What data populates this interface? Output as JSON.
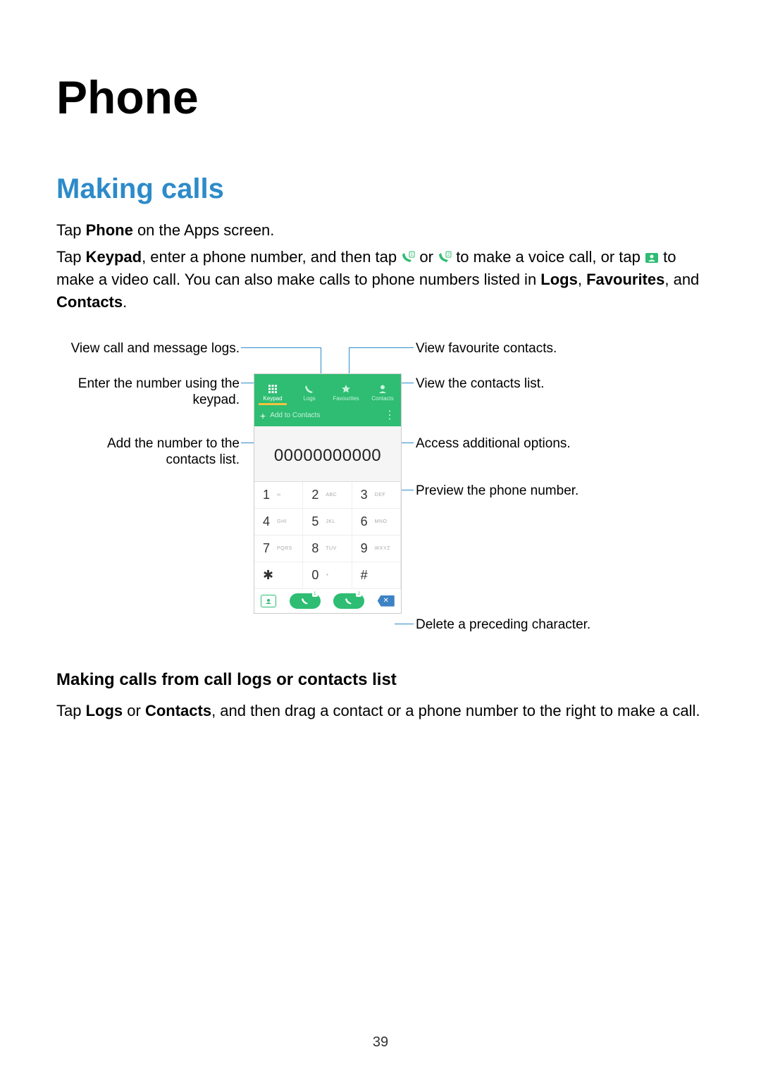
{
  "page": {
    "title": "Phone",
    "section": "Making calls",
    "para1_pre": "Tap ",
    "para1_bold": "Phone",
    "para1_post": " on the Apps screen.",
    "para2_a": "Tap ",
    "para2_keypad": "Keypad",
    "para2_b": ", enter a phone number, and then tap ",
    "para2_c": " or ",
    "para2_d": " to make a voice call, or tap ",
    "para2_e": " to make a video call. You can also make calls to phone numbers listed in ",
    "para2_logs": "Logs",
    "para2_f": ", ",
    "para2_fav": "Favourites",
    "para2_g": ", and ",
    "para2_contacts": "Contacts",
    "para2_h": ".",
    "subheading": "Making calls from call logs or contacts list",
    "para3_a": "Tap ",
    "para3_logs": "Logs",
    "para3_b": " or ",
    "para3_contacts": "Contacts",
    "para3_c": ", and then drag a contact or a phone number to the right to make a call.",
    "page_number": "39"
  },
  "callouts": {
    "left1": "View call and message logs.",
    "left2": "Enter the number using the keypad.",
    "left3": "Add the number to the contacts list.",
    "right1": "View favourite contacts.",
    "right2": "View the contacts list.",
    "right3": "Access additional options.",
    "right4": "Preview the phone number.",
    "right5": "Delete a preceding character."
  },
  "phone": {
    "tabs": [
      "Keypad",
      "Logs",
      "Favourites",
      "Contacts"
    ],
    "add_to_contacts": "Add to Contacts",
    "number": "00000000000",
    "keys": [
      {
        "d": "1",
        "s": ""
      },
      {
        "d": "2",
        "s": "ABC"
      },
      {
        "d": "3",
        "s": "DEF"
      },
      {
        "d": "4",
        "s": "GHI"
      },
      {
        "d": "5",
        "s": "JKL"
      },
      {
        "d": "6",
        "s": "MNO"
      },
      {
        "d": "7",
        "s": "PQRS"
      },
      {
        "d": "8",
        "s": "TUV"
      },
      {
        "d": "9",
        "s": "WXYZ"
      },
      {
        "d": "✱",
        "s": ""
      },
      {
        "d": "0",
        "s": "+"
      },
      {
        "d": "#",
        "s": ""
      }
    ],
    "badge1": "1",
    "badge2": "2"
  }
}
